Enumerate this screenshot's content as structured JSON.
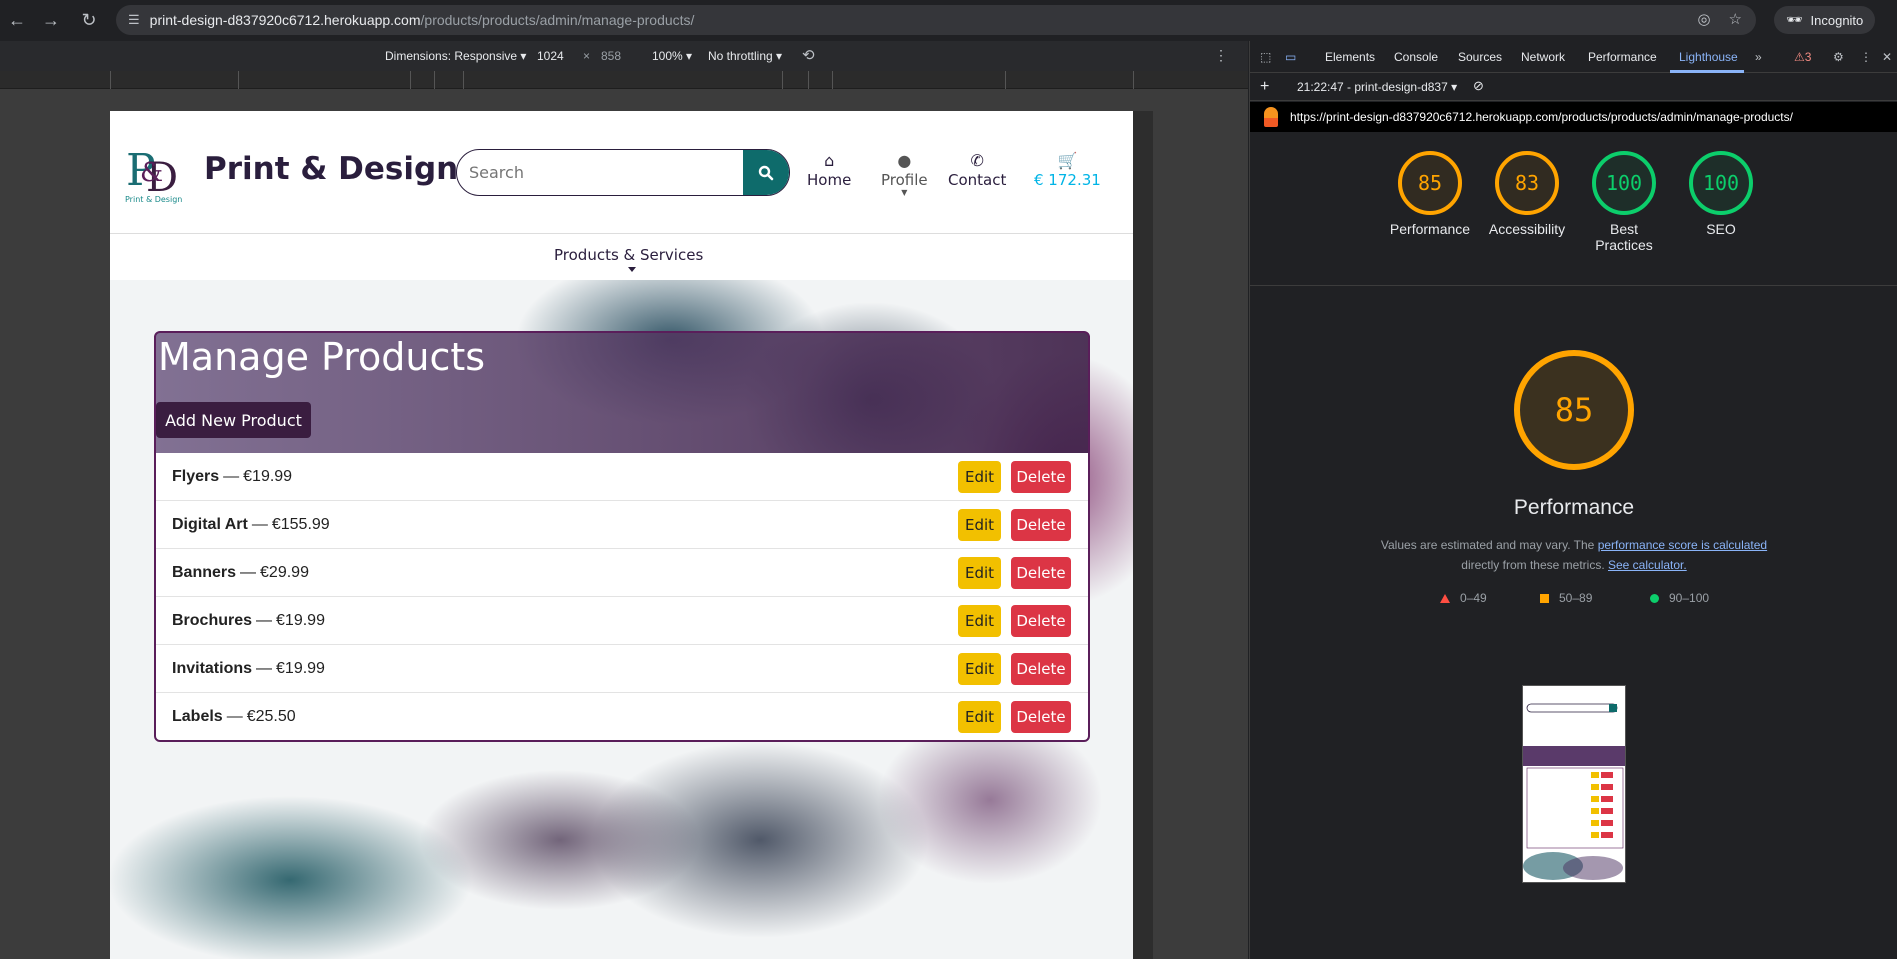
{
  "browser": {
    "url_host": "print-design-d837920c6712.herokuapp.com",
    "url_path": "/products/products/admin/manage-products/",
    "profile_label": "Incognito"
  },
  "device_toolbar": {
    "dimensions_label": "Dimensions: Responsive",
    "width": "1024",
    "height": "858",
    "zoom": "100%",
    "throttling": "No throttling"
  },
  "site": {
    "brand": "Print & Design",
    "logo_caption": "Print & Design",
    "search_placeholder": "Search",
    "nav": {
      "home": "Home",
      "profile": "Profile",
      "contact": "Contact",
      "cart_total": "€ 172.31"
    },
    "subnav": "Products & Services",
    "page_title": "Manage Products",
    "add_button": "Add New Product",
    "edit_label": "Edit",
    "delete_label": "Delete",
    "separator": "—",
    "products": [
      {
        "name": "Flyers",
        "price": "€19.99"
      },
      {
        "name": "Digital Art",
        "price": "€155.99"
      },
      {
        "name": "Banners",
        "price": "€29.99"
      },
      {
        "name": "Brochures",
        "price": "€19.99"
      },
      {
        "name": "Invitations",
        "price": "€19.99"
      },
      {
        "name": "Labels",
        "price": "€25.50"
      }
    ]
  },
  "devtools": {
    "tabs": [
      "Elements",
      "Console",
      "Sources",
      "Network",
      "Performance",
      "Lighthouse"
    ],
    "active_tab": "Lighthouse",
    "issues_count": "3",
    "report_label": "21:22:47 - print-design-d837",
    "report_url": "https://print-design-d837920c6712.herokuapp.com/products/products/admin/manage-products/",
    "scores": [
      {
        "label": "Performance",
        "value": "85",
        "color": "#ffa400"
      },
      {
        "label": "Accessibility",
        "value": "83",
        "color": "#ffa400"
      },
      {
        "label": "Best Practices",
        "value": "100",
        "color": "#0cce6b"
      },
      {
        "label": "SEO",
        "value": "100",
        "color": "#0cce6b"
      }
    ],
    "main_score": "85",
    "main_title": "Performance",
    "note_pre": "Values are estimated and may vary. The",
    "note_link1": "performance score is calculated",
    "note_mid": "directly from these metrics.",
    "note_link2": "See calculator.",
    "legend": {
      "fail": "0–49",
      "average": "50–89",
      "pass": "90–100"
    }
  }
}
